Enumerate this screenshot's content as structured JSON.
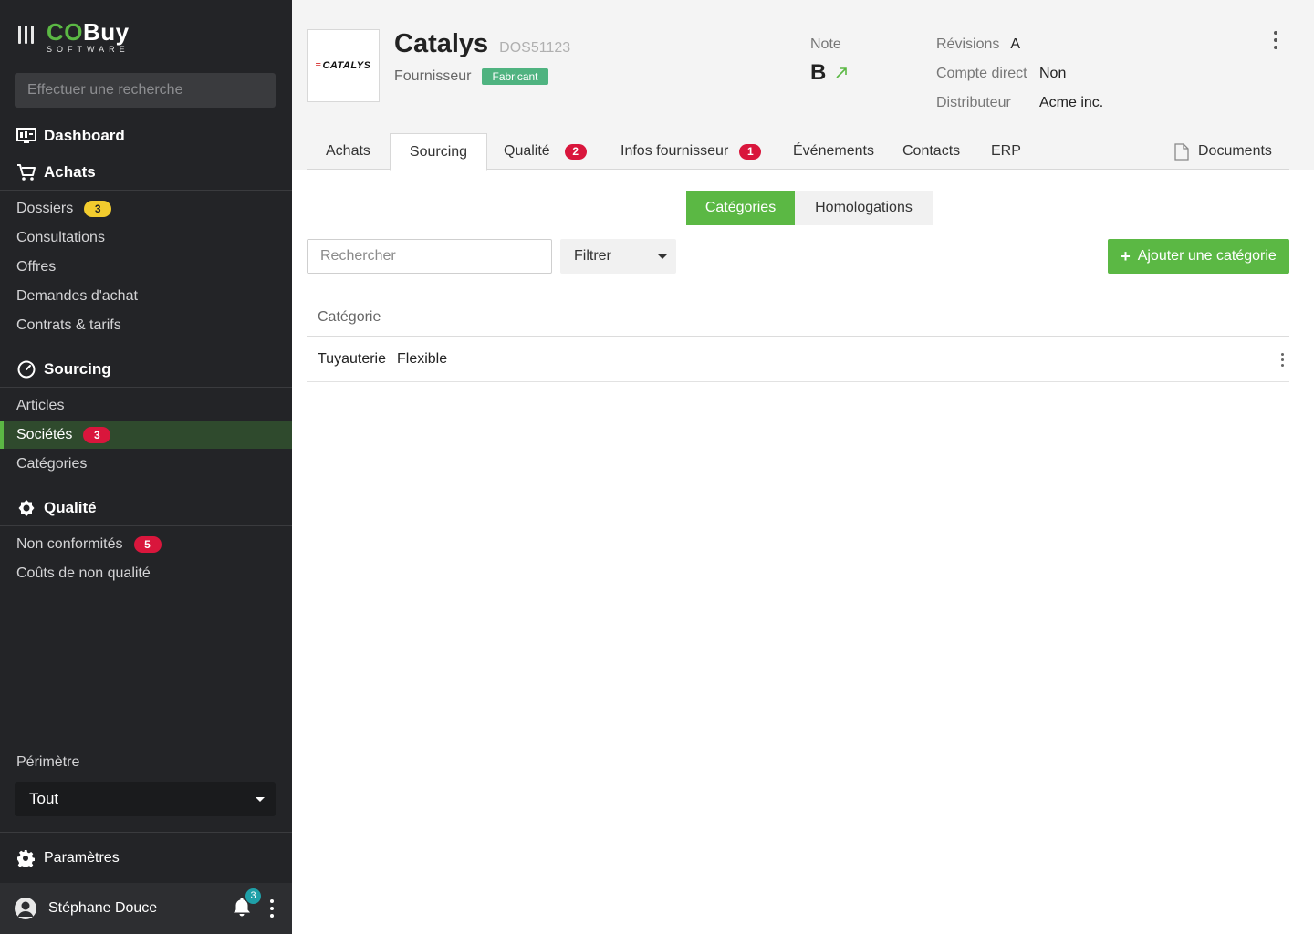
{
  "brand": {
    "co": "CO",
    "buy": "Buy",
    "sub": "SOFTWARE"
  },
  "sidebar": {
    "search_placeholder": "Effectuer une recherche",
    "dashboard": "Dashboard",
    "achats": {
      "label": "Achats",
      "items": [
        {
          "label": "Dossiers",
          "badge": "3"
        },
        {
          "label": "Consultations"
        },
        {
          "label": "Offres"
        },
        {
          "label": "Demandes d'achat"
        },
        {
          "label": "Contrats & tarifs"
        }
      ]
    },
    "sourcing": {
      "label": "Sourcing",
      "items": [
        {
          "label": "Articles"
        },
        {
          "label": "Sociétés",
          "badge": "3",
          "active": true
        },
        {
          "label": "Catégories"
        }
      ]
    },
    "qualite": {
      "label": "Qualité",
      "items": [
        {
          "label": "Non conformités",
          "badge": "5"
        },
        {
          "label": "Coûts de non qualité"
        }
      ]
    },
    "perimetre_label": "Périmètre",
    "perimetre_value": "Tout",
    "settings": "Paramètres",
    "user": {
      "name": "Stéphane Douce",
      "notifications": "3"
    }
  },
  "header": {
    "logo_text": "CATALYS",
    "title": "Catalys",
    "code": "DOS51123",
    "type": "Fournisseur",
    "tag": "Fabricant",
    "note_label": "Note",
    "note_value": "B",
    "info": [
      {
        "label": "Révisions",
        "value": "A"
      },
      {
        "label": "Compte direct",
        "value": "Non"
      },
      {
        "label": "Distributeur",
        "value": "Acme inc."
      }
    ]
  },
  "tabs": [
    {
      "label": "Achats"
    },
    {
      "label": "Sourcing",
      "active": true
    },
    {
      "label": "Qualité",
      "badge": "2"
    },
    {
      "label": "Infos fournisseur",
      "badge": "1"
    },
    {
      "label": "Événements"
    },
    {
      "label": "Contacts"
    },
    {
      "label": "ERP"
    },
    {
      "label": "Documents"
    }
  ],
  "main": {
    "segments": {
      "active": "Catégories",
      "inactive": "Homologations"
    },
    "search_placeholder": "Rechercher",
    "filter_label": "Filtrer",
    "add_button": "Ajouter une catégorie",
    "table": {
      "header": "Catégorie",
      "rows": [
        {
          "col1": "Tuyauterie",
          "col2": "Flexible"
        }
      ]
    }
  },
  "colors": {
    "accent_green": "#5bb844",
    "badge_red": "#d9163c",
    "badge_yellow": "#f2cc2e",
    "sidebar_bg": "#232427"
  }
}
